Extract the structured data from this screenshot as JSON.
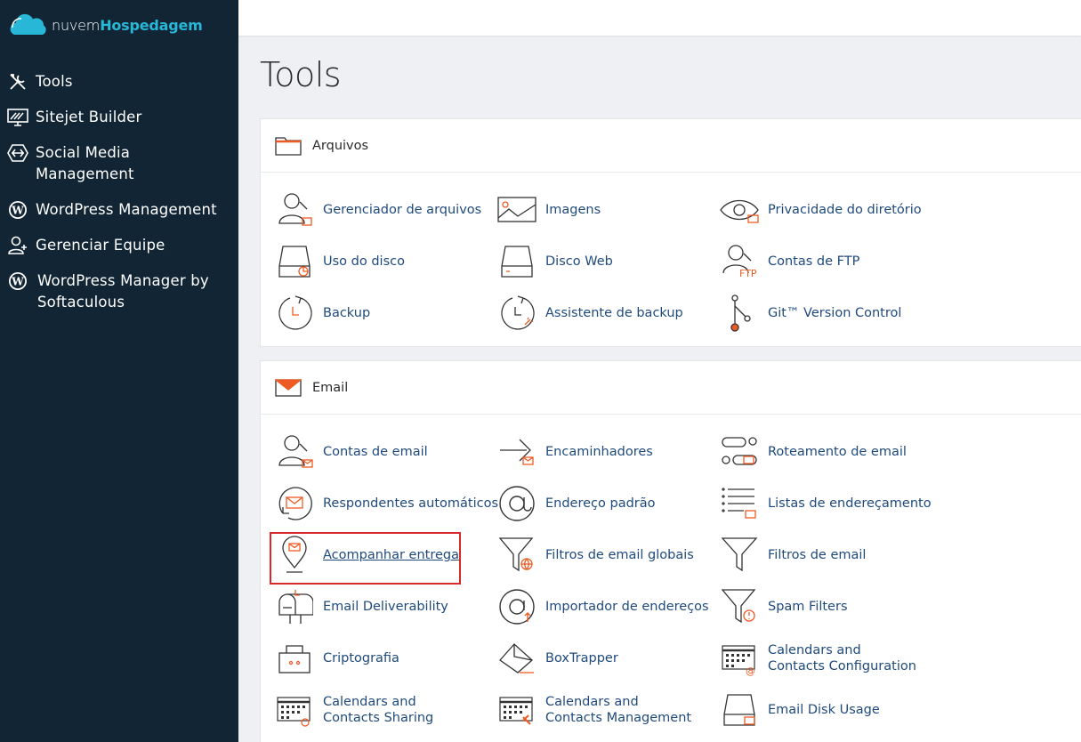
{
  "brand": {
    "part1": "nuvem",
    "part2": "Hospedagem"
  },
  "sidebar": {
    "items": [
      {
        "label": "Tools",
        "icon": "tools-icon"
      },
      {
        "label": "Sitejet Builder",
        "icon": "sitejet-icon"
      },
      {
        "label": "Social Media Management",
        "icon": "social-media-icon"
      },
      {
        "label": "WordPress Management",
        "icon": "wordpress-icon"
      },
      {
        "label": "Gerenciar Equipe",
        "icon": "team-icon"
      },
      {
        "label": "WordPress Manager by Softaculous",
        "icon": "wordpress-icon"
      }
    ]
  },
  "page": {
    "title": "Tools"
  },
  "sections": [
    {
      "title": "Arquivos",
      "icon": "folder-icon",
      "items": [
        {
          "label": "Gerenciador de arquivos",
          "icon": "file-manager-icon"
        },
        {
          "label": "Imagens",
          "icon": "images-icon"
        },
        {
          "label": "Privacidade do diretório",
          "icon": "directory-privacy-icon"
        },
        {
          "label": "Uso do disco",
          "icon": "disk-usage-icon"
        },
        {
          "label": "Disco Web",
          "icon": "web-disk-icon"
        },
        {
          "label": "Contas de FTP",
          "icon": "ftp-accounts-icon"
        },
        {
          "label": "Backup",
          "icon": "backup-icon"
        },
        {
          "label": "Assistente de backup",
          "icon": "backup-wizard-icon"
        },
        {
          "label": "Git™ Version Control",
          "icon": "git-icon"
        }
      ]
    },
    {
      "title": "Email",
      "icon": "envelope-icon",
      "items": [
        {
          "label": "Contas de email",
          "icon": "email-accounts-icon"
        },
        {
          "label": "Encaminhadores",
          "icon": "forwarders-icon"
        },
        {
          "label": "Roteamento de email",
          "icon": "email-routing-icon"
        },
        {
          "label": "Respondentes automáticos",
          "icon": "autoresponders-icon"
        },
        {
          "label": "Endereço padrão",
          "icon": "default-address-icon"
        },
        {
          "label": "Listas de endereçamento",
          "icon": "mailing-lists-icon"
        },
        {
          "label": "Acompanhar entrega",
          "icon": "track-delivery-icon"
        },
        {
          "label": "Filtros de email globais",
          "icon": "global-filters-icon"
        },
        {
          "label": "Filtros de email",
          "icon": "email-filters-icon"
        },
        {
          "label": "Email Deliverability",
          "icon": "mailbox-icon"
        },
        {
          "label": "Importador de endereços",
          "icon": "address-importer-icon"
        },
        {
          "label": "Spam Filters",
          "icon": "spam-filters-icon"
        },
        {
          "label": "Criptografia",
          "icon": "encryption-icon"
        },
        {
          "label": "BoxTrapper",
          "icon": "boxtrapper-icon"
        },
        {
          "label": "Calendars and Contacts Configuration",
          "icon": "calendar-config-icon"
        },
        {
          "label": "Calendars and Contacts Sharing",
          "icon": "calendar-sharing-icon"
        },
        {
          "label": "Calendars and Contacts Management",
          "icon": "calendar-management-icon"
        },
        {
          "label": "Email Disk Usage",
          "icon": "email-disk-usage-icon"
        }
      ]
    }
  ],
  "colors": {
    "sidebar": "#112534",
    "accent": "#ee5a24",
    "link": "#1f4a7c",
    "highlight": "#d62a2a",
    "brand": "#29b7d8"
  }
}
